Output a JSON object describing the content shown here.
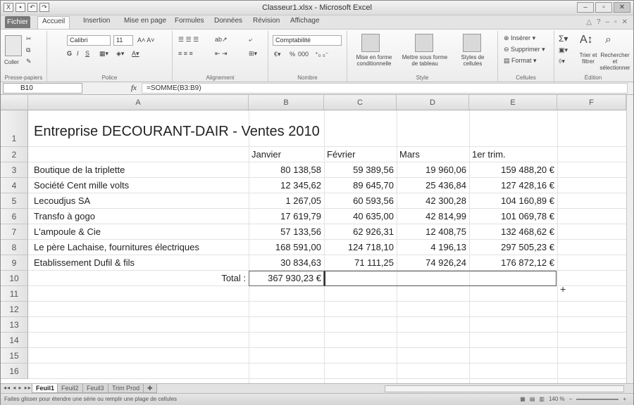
{
  "app": {
    "title": "Classeur1.xlsx - Microsoft Excel"
  },
  "tabs": [
    "Fichier",
    "Accueil",
    "Insertion",
    "Mise en page",
    "Formules",
    "Données",
    "Révision",
    "Affichage"
  ],
  "ribbon": {
    "paste": "Coller",
    "font_name": "Calibri",
    "font_size": "11",
    "number_format": "Comptabilité",
    "percent": "%",
    "thousands": "000",
    "cond_format": "Mise en forme conditionnelle",
    "table_format": "Mettre sous forme de tableau",
    "cell_styles": "Styles de cellules",
    "insert": "Insérer",
    "delete": "Supprimer",
    "format": "Format",
    "sort": "Trier et filtrer",
    "find": "Rechercher et sélectionner",
    "groups": [
      "Presse-papiers",
      "Police",
      "Alignement",
      "Nombre",
      "Style",
      "Cellules",
      "Édition"
    ]
  },
  "formula_bar": {
    "name_box": "B10",
    "fx": "fx",
    "formula": "=SOMME(B3:B9)"
  },
  "columns": [
    "A",
    "B",
    "C",
    "D",
    "E",
    "F"
  ],
  "rows": [
    "1",
    "2",
    "3",
    "4",
    "5",
    "6",
    "7",
    "8",
    "9",
    "10",
    "11",
    "12",
    "13",
    "14",
    "15",
    "16"
  ],
  "sheet": {
    "title": "Entreprise DECOURANT-DAIR - Ventes 2010",
    "headers": [
      "Janvier",
      "Février",
      "Mars",
      "1er trim."
    ],
    "data": [
      {
        "name": "Boutique de la triplette",
        "jan": "80 138,58",
        "feb": "59 389,56",
        "mar": "19 960,06",
        "q1": "159 488,20 €"
      },
      {
        "name": "Société Cent mille volts",
        "jan": "12 345,62",
        "feb": "89 645,70",
        "mar": "25 436,84",
        "q1": "127 428,16 €"
      },
      {
        "name": "Lecoudjus SA",
        "jan": "1 267,05",
        "feb": "60 593,56",
        "mar": "42 300,28",
        "q1": "104 160,89 €"
      },
      {
        "name": "Transfo à gogo",
        "jan": "17 619,79",
        "feb": "40 635,00",
        "mar": "42 814,99",
        "q1": "101 069,78 €"
      },
      {
        "name": "L'ampoule & Cie",
        "jan": "57 133,56",
        "feb": "62 926,31",
        "mar": "12 408,75",
        "q1": "132 468,62 €"
      },
      {
        "name": "Le père Lachaise, fournitures électriques",
        "jan": "168 591,00",
        "feb": "124 718,10",
        "mar": "4 196,13",
        "q1": "297 505,23 €"
      },
      {
        "name": "Etablissement Dufil & fils",
        "jan": "30 834,63",
        "feb": "71 111,25",
        "mar": "74 926,24",
        "q1": "176 872,12 €"
      }
    ],
    "total_label": "Total :",
    "total_value": "367 930,23 €"
  },
  "sheet_tabs": [
    "Feuil1",
    "Feuil2",
    "Feuil3",
    "Trim Prod"
  ],
  "active_sheet": "Feuil1",
  "status": {
    "text": "Faites glisser pour étendre une série ou remplir une plage de cellules",
    "zoom": "140 %"
  }
}
